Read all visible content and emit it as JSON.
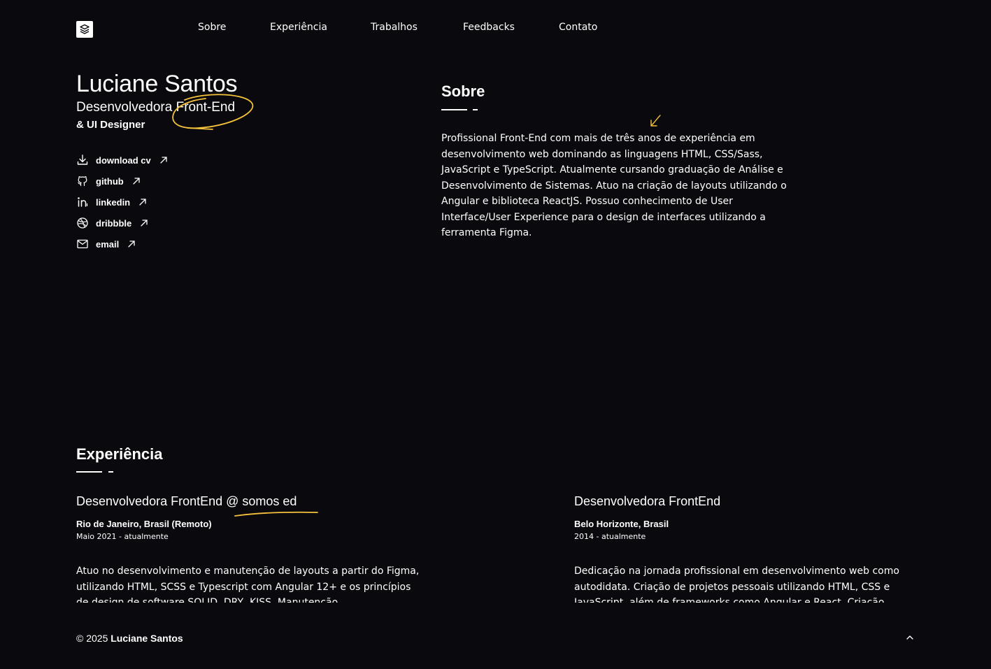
{
  "nav": {
    "logo_icon": "layers-icon",
    "items": [
      "Sobre",
      "Experiência",
      "Trabalhos",
      "Feedbacks",
      "Contato"
    ]
  },
  "hero": {
    "name": "Luciane Santos",
    "role": "Desenvolvedora Front-End",
    "subtitle": "& UI Designer",
    "accent_color": "#f5c23b",
    "links": [
      {
        "label": "download cv",
        "icon": "download-icon"
      },
      {
        "label": "github",
        "icon": "github-icon"
      },
      {
        "label": "linkedin",
        "icon": "linkedin-icon"
      },
      {
        "label": "dribbble",
        "icon": "dribbble-icon"
      },
      {
        "label": "email",
        "icon": "mail-icon"
      }
    ]
  },
  "about": {
    "title": "Sobre",
    "text": "Profissional Front-End com mais de três anos de experiência em desenvolvimento web dominando as linguagens HTML, CSS/Sass, JavaScript e TypeScript. Atualmente cursando graduação de Análise e Desenvolvimento de Sistemas. Atuo na criação de layouts utilizando o Angular e biblioteca ReactJS. Possuo conhecimento de User Interface/User Experience para o design de interfaces utilizando a ferramenta Figma."
  },
  "experience": {
    "title": "Experiência",
    "jobs": [
      {
        "title": "Desenvolvedora FrontEnd @ somos ed",
        "location": "Rio de Janeiro, Brasil (Remoto)",
        "period": "Maio 2021 - atualmente",
        "description": "Atuo no desenvolvimento e manutenção de layouts a partir do Figma, utilizando HTML, SCSS e Typescript com Angular 12+ e os princípios de design de software SOLID, DRY, KISS. Manutenção"
      },
      {
        "title": "Desenvolvedora FrontEnd",
        "location": "Belo Horizonte, Brasil",
        "period": "2014 - atualmente",
        "description": "Dedicação na jornada profissional em desenvolvimento web como autodidata. Criação de projetos pessoais utilizando HTML, CSS e JavaScript, além de frameworks como Angular e React. Criação"
      }
    ]
  },
  "footer": {
    "copyright_prefix": "© 2025",
    "copyright_name": "Luciane Santos",
    "back_to_top_icon": "chevron-up-icon"
  }
}
